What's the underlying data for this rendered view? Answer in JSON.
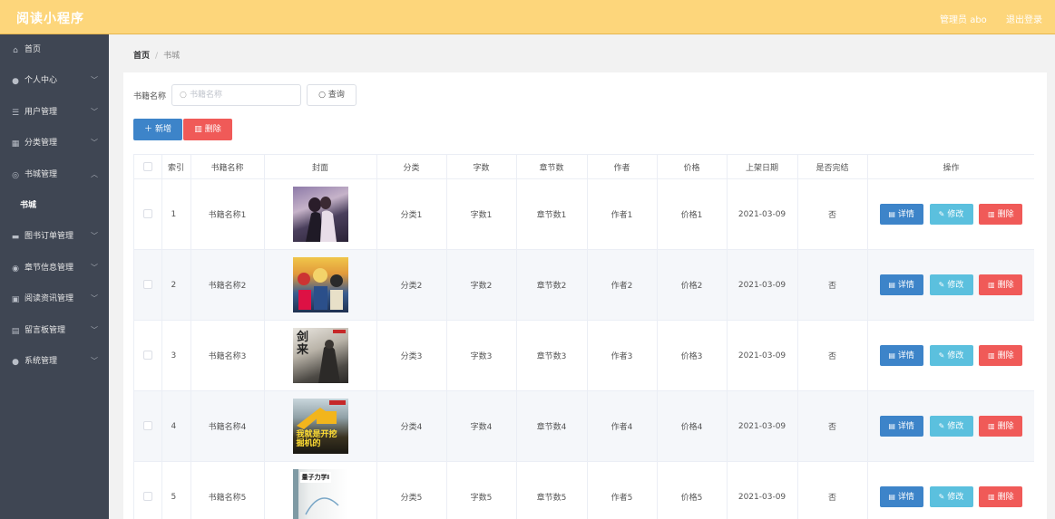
{
  "app": {
    "title": "阅读小程序"
  },
  "header": {
    "user_label": "管理员 abo",
    "logout_label": "退出登录"
  },
  "sidebar": {
    "items": [
      {
        "label": "首页",
        "icon": "home-icon",
        "has_arrow": false
      },
      {
        "label": "个人中心",
        "icon": "user-icon",
        "has_arrow": true
      },
      {
        "label": "用户管理",
        "icon": "sliders-icon",
        "has_arrow": true
      },
      {
        "label": "分类管理",
        "icon": "grid-icon",
        "has_arrow": true
      },
      {
        "label": "书城管理",
        "icon": "globe-icon",
        "has_arrow": true,
        "expanded": true
      },
      {
        "label": "书城",
        "sub": true
      },
      {
        "label": "图书订单管理",
        "icon": "book-icon",
        "has_arrow": true
      },
      {
        "label": "章节信息管理",
        "icon": "compass-icon",
        "has_arrow": true
      },
      {
        "label": "阅读资讯管理",
        "icon": "clipboard-icon",
        "has_arrow": true
      },
      {
        "label": "留言板管理",
        "icon": "chat-icon",
        "has_arrow": true
      },
      {
        "label": "系统管理",
        "icon": "user-icon",
        "has_arrow": true
      }
    ]
  },
  "breadcrumb": {
    "home": "首页",
    "separator": "/",
    "current": "书城"
  },
  "search": {
    "label": "书籍名称",
    "placeholder": "书籍名称",
    "query_label": "查询"
  },
  "toolbar": {
    "add_label": "新增",
    "delete_label": "删除"
  },
  "table": {
    "headers": [
      "索引",
      "书籍名称",
      "封面",
      "分类",
      "字数",
      "章节数",
      "作者",
      "价格",
      "上架日期",
      "是否完结",
      "操作"
    ],
    "row_actions": {
      "detail": "详情",
      "edit": "修改",
      "delete": "删除"
    },
    "rows": [
      {
        "index": "1",
        "name": "书籍名称1",
        "category": "分类1",
        "words": "字数1",
        "chapters": "章节数1",
        "author": "作者1",
        "price": "价格1",
        "date": "2021-03-09",
        "finished": "否"
      },
      {
        "index": "2",
        "name": "书籍名称2",
        "category": "分类2",
        "words": "字数2",
        "chapters": "章节数2",
        "author": "作者2",
        "price": "价格2",
        "date": "2021-03-09",
        "finished": "否"
      },
      {
        "index": "3",
        "name": "书籍名称3",
        "category": "分类3",
        "words": "字数3",
        "chapters": "章节数3",
        "author": "作者3",
        "price": "价格3",
        "date": "2021-03-09",
        "finished": "否"
      },
      {
        "index": "4",
        "name": "书籍名称4",
        "category": "分类4",
        "words": "字数4",
        "chapters": "章节数4",
        "author": "作者4",
        "price": "价格4",
        "date": "2021-03-09",
        "finished": "否"
      },
      {
        "index": "5",
        "name": "书籍名称5",
        "category": "分类5",
        "words": "字数5",
        "chapters": "章节数5",
        "author": "作者5",
        "price": "价格5",
        "date": "2021-03-09",
        "finished": "否"
      }
    ],
    "covers": [
      {
        "caption": ""
      },
      {
        "caption": ""
      },
      {
        "caption": "剑来"
      },
      {
        "caption": "我就是开挖掘机的"
      },
      {
        "caption": "量子力学I"
      }
    ]
  },
  "colors": {
    "header_bg": "#fdd67b",
    "sidebar_bg": "#3f4653",
    "primary": "#3d84c9",
    "danger": "#f05a58",
    "info": "#5bc0de"
  }
}
